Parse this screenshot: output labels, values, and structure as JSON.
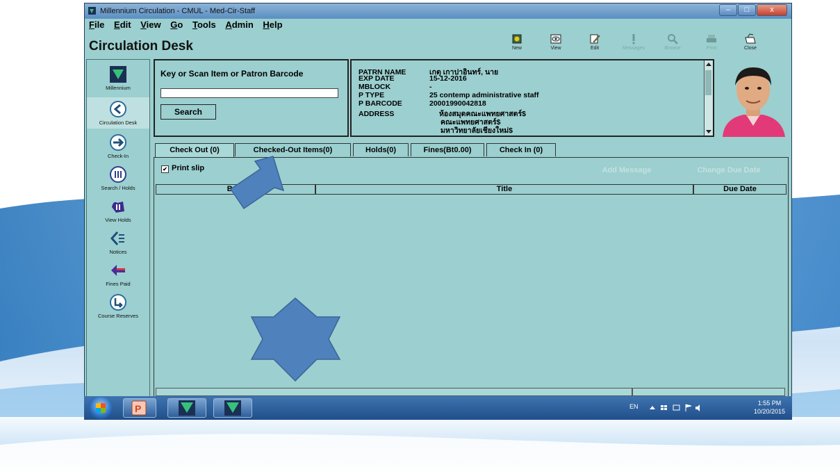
{
  "window": {
    "title": "Millennium Circulation - CMUL - Med-Cir-Staff",
    "controls": {
      "minimize": "–",
      "maximize": "□",
      "close": "x"
    }
  },
  "menu": [
    "File",
    "Edit",
    "View",
    "Go",
    "Tools",
    "Admin",
    "Help"
  ],
  "page_title": "Circulation Desk",
  "toolbar": [
    {
      "label": "New",
      "icon": "new-icon",
      "enabled": true
    },
    {
      "label": "View",
      "icon": "view-icon",
      "enabled": true
    },
    {
      "label": "Edit",
      "icon": "edit-icon",
      "enabled": true
    },
    {
      "label": "Messages",
      "icon": "messages-icon",
      "enabled": false
    },
    {
      "label": "Browse",
      "icon": "browse-icon",
      "enabled": false
    },
    {
      "label": "Print",
      "icon": "print-icon",
      "enabled": false
    },
    {
      "label": "Close",
      "icon": "close-icon",
      "enabled": true
    }
  ],
  "sidebar": [
    {
      "label": "Millennium",
      "icon": "millennium-logo-icon",
      "active": false
    },
    {
      "label": "Circulation Desk",
      "icon": "circulation-desk-icon",
      "active": true
    },
    {
      "label": "Check-In",
      "icon": "check-in-icon",
      "active": false
    },
    {
      "label": "Search / Holds",
      "icon": "search-holds-icon",
      "active": false
    },
    {
      "label": "View Holds",
      "icon": "view-holds-icon",
      "active": false
    },
    {
      "label": "Notices",
      "icon": "notices-icon",
      "active": false
    },
    {
      "label": "Fines Paid",
      "icon": "fines-paid-icon",
      "active": false
    },
    {
      "label": "Course Reserves",
      "icon": "course-reserves-icon",
      "active": false
    }
  ],
  "scan": {
    "label": "Key or Scan Item or Patron Barcode",
    "value": "",
    "search_label": "Search"
  },
  "patron": {
    "fields": [
      {
        "key": "PATRN NAME",
        "value": "เกตุ เกาปาอินทร์, นาย"
      },
      {
        "key": "EXP DATE",
        "value": "15-12-2016"
      },
      {
        "key": "MBLOCK",
        "value": "-"
      },
      {
        "key": "P TYPE",
        "value": "25 contemp administrative staff"
      },
      {
        "key": "P BARCODE",
        "value": "20001990042818"
      },
      {
        "key": "ADDRESS",
        "value": "ห้องสมุดคณะแพทยศาสตร์$"
      }
    ],
    "address_more": [
      "คณะแพทยศาสตร์$",
      "มหาวิทยาลัยเชียงใหม่$"
    ]
  },
  "tabs": [
    {
      "label": "Check Out (0)",
      "active": true
    },
    {
      "label": "Checked-Out Items(0)",
      "active": false
    },
    {
      "label": "Holds(0)",
      "active": false
    },
    {
      "label": "Fines(Bt0.00)",
      "active": false
    },
    {
      "label": "Check In (0)",
      "active": false
    }
  ],
  "checkout": {
    "print_slip_label": "Print slip",
    "print_slip_checked": true,
    "add_message_label": "Add Message",
    "change_due_date_label": "Change Due Date",
    "columns": [
      "Barc",
      "Title",
      "Due Date"
    ]
  },
  "taskbar": {
    "apps": [
      "windows-start-icon",
      "powerpoint-icon",
      "millennium-app-icon",
      "millennium-app-icon"
    ],
    "tray": {
      "lang": "EN"
    },
    "time": "1:55 PM",
    "date": "10/20/2015"
  },
  "colors": {
    "window_bg": "#9ccfcf",
    "annotation_blue": "#4f81bd",
    "annotation_border": "#3a6597"
  }
}
